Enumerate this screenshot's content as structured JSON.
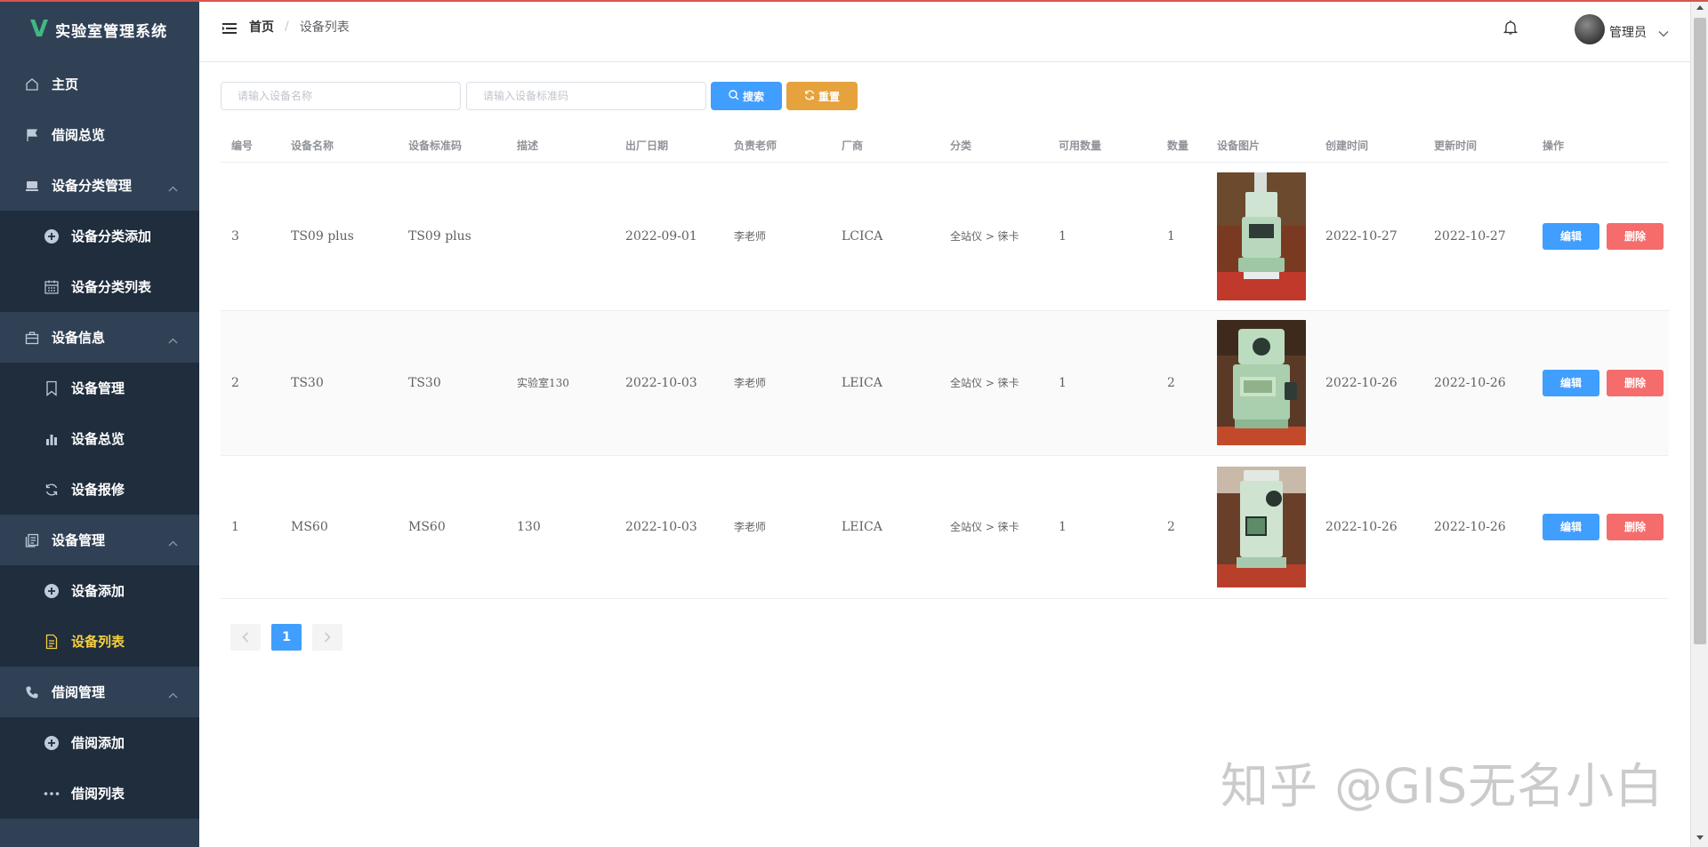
{
  "app": {
    "logo_letter": "V",
    "title": "实验室管理系统"
  },
  "sidebar": {
    "items": [
      {
        "label": "主页",
        "icon": "home-icon",
        "level": 1
      },
      {
        "label": "借阅总览",
        "icon": "flag-icon",
        "level": 1
      },
      {
        "label": "设备分类管理",
        "icon": "laptop-icon",
        "level": 1,
        "expanded": true
      },
      {
        "label": "设备分类添加",
        "icon": "circle-plus-icon",
        "level": 2
      },
      {
        "label": "设备分类列表",
        "icon": "calendar-icon",
        "level": 2
      },
      {
        "label": "设备信息",
        "icon": "briefcase-icon",
        "level": 1,
        "expanded": true
      },
      {
        "label": "设备管理",
        "icon": "bookmark-icon",
        "level": 2
      },
      {
        "label": "设备总览",
        "icon": "bar-chart-icon",
        "level": 2
      },
      {
        "label": "设备报修",
        "icon": "refresh-icon",
        "level": 2
      },
      {
        "label": "设备管理",
        "icon": "tickets-icon",
        "level": 1,
        "expanded": true
      },
      {
        "label": "设备添加",
        "icon": "circle-plus-icon",
        "level": 2
      },
      {
        "label": "设备列表",
        "icon": "document-icon",
        "level": 2,
        "active": true
      },
      {
        "label": "借阅管理",
        "icon": "phone-icon",
        "level": 1,
        "expanded": true
      },
      {
        "label": "借阅添加",
        "icon": "circle-plus-icon",
        "level": 2
      },
      {
        "label": "借阅列表",
        "icon": "more-icon",
        "level": 2
      }
    ]
  },
  "header": {
    "breadcrumb_home": "首页",
    "breadcrumb_separator": "/",
    "breadcrumb_current": "设备列表",
    "user_name": "管理员"
  },
  "search": {
    "name_placeholder": "请输入设备名称",
    "code_placeholder": "请输入设备标准码",
    "search_label": "搜索",
    "reset_label": "重置"
  },
  "table": {
    "columns": [
      "编号",
      "设备名称",
      "设备标准码",
      "描述",
      "出厂日期",
      "负责老师",
      "厂商",
      "分类",
      "可用数量",
      "数量",
      "设备图片",
      "创建时间",
      "更新时间",
      "操作"
    ],
    "rows": [
      {
        "id": "3",
        "name": "TS09 plus",
        "code": "TS09 plus",
        "desc": "",
        "date": "2022-09-01",
        "teacher": "李老师",
        "vendor": "LCICA",
        "category": "全站仪 > 徕卡",
        "available": "1",
        "qty": "1",
        "created": "2022-10-27",
        "updated": "2022-10-27"
      },
      {
        "id": "2",
        "name": "TS30",
        "code": "TS30",
        "desc": "实验室130",
        "date": "2022-10-03",
        "teacher": "李老师",
        "vendor": "LEICA",
        "category": "全站仪 > 徕卡",
        "available": "1",
        "qty": "2",
        "created": "2022-10-26",
        "updated": "2022-10-26"
      },
      {
        "id": "1",
        "name": "MS60",
        "code": "MS60",
        "desc": "130",
        "date": "2022-10-03",
        "teacher": "李老师",
        "vendor": "LEICA",
        "category": "全站仪 > 徕卡",
        "available": "1",
        "qty": "2",
        "created": "2022-10-26",
        "updated": "2022-10-26"
      }
    ],
    "edit_label": "编辑",
    "delete_label": "删除"
  },
  "pagination": {
    "current_page": "1",
    "prev_icon": "chevron-left-icon",
    "next_icon": "chevron-right-icon"
  },
  "watermark": "知乎 @GIS无名小白",
  "colors": {
    "sidebar_bg": "#304156",
    "sidebar_sub_bg": "#1f2d3d",
    "active_text": "#f4d03f",
    "primary": "#409eff",
    "warning": "#e6a23c",
    "danger": "#f56c6c",
    "logo_green": "#41b883"
  }
}
